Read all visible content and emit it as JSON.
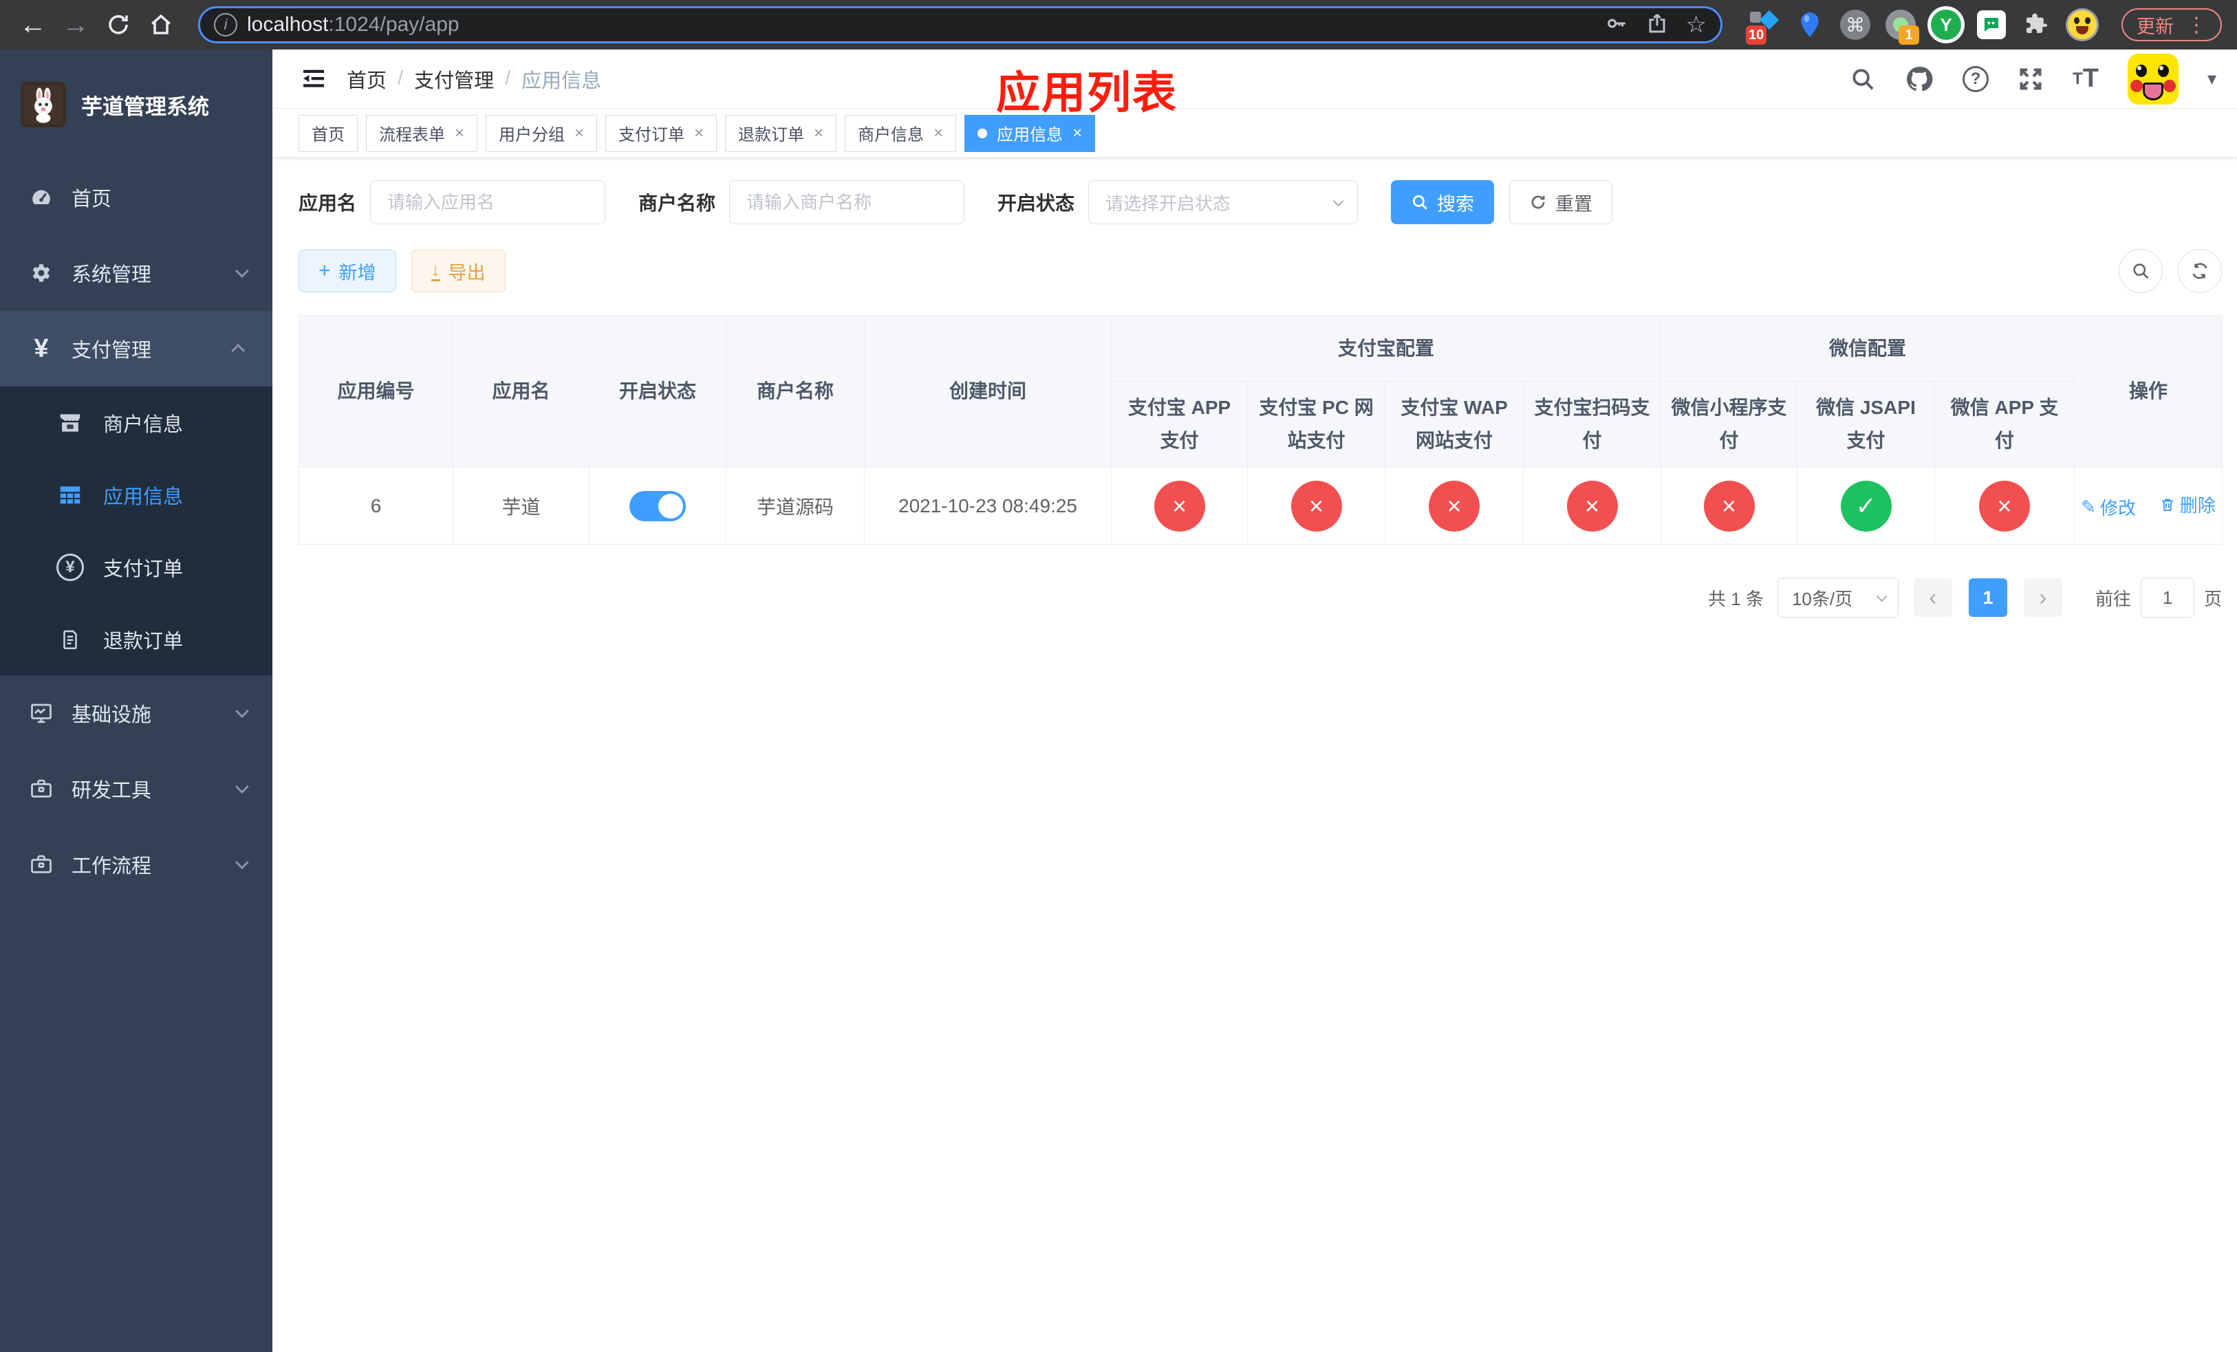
{
  "colors": {
    "accent": "#409eff",
    "success": "#1ec15f",
    "danger": "#f25050",
    "warning": "#e6a23c",
    "overlay_red": "#fb1e0e",
    "sidebar_bg": "#344155",
    "submenu_bg": "#1f2d3d"
  },
  "browser": {
    "url_host": "localhost",
    "url_rest": ":1024/pay/app",
    "ext_badge_1": "10",
    "ext_badge_2": "1",
    "ext_y_label": "Y",
    "update_label": "更新"
  },
  "sidebar": {
    "title": "芋道管理系统",
    "items": [
      {
        "label": "首页"
      },
      {
        "label": "系统管理"
      },
      {
        "label": "支付管理"
      },
      {
        "label": "基础设施"
      },
      {
        "label": "研发工具"
      },
      {
        "label": "工作流程"
      }
    ],
    "submenu": [
      {
        "label": "商户信息"
      },
      {
        "label": "应用信息"
      },
      {
        "label": "支付订单"
      },
      {
        "label": "退款订单"
      }
    ]
  },
  "header": {
    "breadcrumb": [
      "首页",
      "支付管理",
      "应用信息"
    ],
    "sep": "/",
    "overlay_title": "应用列表",
    "font_small": "T",
    "font_big": "T"
  },
  "tabs": {
    "items": [
      {
        "label": "首页"
      },
      {
        "label": "流程表单"
      },
      {
        "label": "用户分组"
      },
      {
        "label": "支付订单"
      },
      {
        "label": "退款订单"
      },
      {
        "label": "商户信息"
      },
      {
        "label": "应用信息"
      }
    ]
  },
  "filters": {
    "app_name_label": "应用名",
    "app_name_placeholder": "请输入应用名",
    "merchant_label": "商户名称",
    "merchant_placeholder": "请输入商户名称",
    "status_label": "开启状态",
    "status_placeholder": "请选择开启状态",
    "search_label": "搜索",
    "reset_label": "重置"
  },
  "toolbar": {
    "add_label": "新增",
    "export_label": "导出"
  },
  "table": {
    "headers": {
      "main": [
        "应用编号",
        "应用名",
        "开启状态",
        "商户名称",
        "创建时间"
      ],
      "group_alipay": "支付宝配置",
      "group_wechat": "微信配置",
      "sub": [
        "支付宝 APP 支付",
        "支付宝 PC 网站支付",
        "支付宝 WAP 网站支付",
        "支付宝扫码支付",
        "微信小程序支付",
        "微信 JSAPI 支付",
        "微信 APP 支付"
      ],
      "ops": "操作"
    },
    "row": {
      "id": "6",
      "name": "芋道",
      "merchant": "芋道源码",
      "created": "2021-10-23 08:49:25",
      "pay_status": [
        "no",
        "no",
        "no",
        "no",
        "no",
        "yes",
        "no"
      ],
      "edit": "修改",
      "delete": "删除"
    }
  },
  "pagination": {
    "total": "共 1 条",
    "page_size": "10条/页",
    "current": "1",
    "jump_prefix": "前往",
    "jump_value": "1",
    "jump_suffix": "页"
  },
  "icons": {
    "check": "✓",
    "cross": "×",
    "tab_close": "×",
    "back": "←",
    "forward": "→",
    "command": "⌘",
    "kebab": "⋮",
    "star": "☆",
    "pen": "✎",
    "plus": "+",
    "download": "↓",
    "question": "?",
    "info": "i",
    "caret": "▾",
    "prev": "‹",
    "next": "›",
    "yen": "¥"
  }
}
